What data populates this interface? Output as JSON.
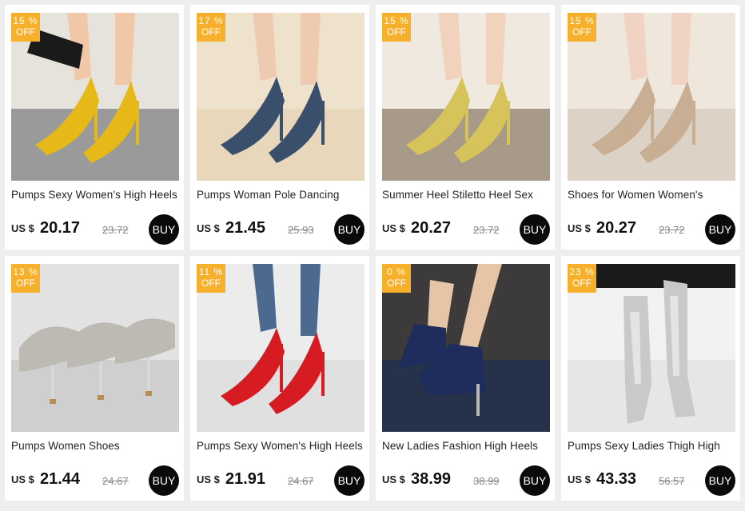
{
  "currency_label": "US $",
  "discount_suffix": "OFF",
  "buy_label": "BUY",
  "products": [
    {
      "title": "Pumps Sexy Women's High Heels",
      "discount": "15 %",
      "price": "20.17",
      "old_price": "23.72",
      "image": {
        "bg": "#e6e2dc",
        "floor": "#9a9a9a",
        "shoe": "#e6b818",
        "leg": "#f0c8a8",
        "accent": "#1a1a1a"
      }
    },
    {
      "title": "Pumps Woman Pole Dancing",
      "discount": "17 %",
      "price": "21.45",
      "old_price": "25.93",
      "image": {
        "bg": "#efe2cc",
        "floor": "#e9d7bc",
        "shoe": "#3a4f6c",
        "leg": "#edcab0",
        "accent": "#111111"
      }
    },
    {
      "title": "Summer Heel Stiletto Heel Sex",
      "discount": "15 %",
      "price": "20.27",
      "old_price": "23.72",
      "image": {
        "bg": "#efe9df",
        "floor": "#a79a88",
        "shoe": "#d6c35a",
        "leg": "#f0d2bd",
        "accent": "#ffffff"
      }
    },
    {
      "title": "Shoes for Women Women's",
      "discount": "15 %",
      "price": "20.27",
      "old_price": "23.72",
      "image": {
        "bg": "#efe6dc",
        "floor": "#dcd2c6",
        "shoe": "#c8ae92",
        "leg": "#f0d3c2",
        "accent": "#f3efe8"
      }
    },
    {
      "title": "Pumps  Women Shoes",
      "discount": "13 %",
      "price": "21.44",
      "old_price": "24.67",
      "image": {
        "bg": "#e2e2e2",
        "floor": "#cfcfcf",
        "shoe": "#bcbab2",
        "leg": "#c8c8c8",
        "accent": "#b88d55"
      }
    },
    {
      "title": "Pumps Sexy Women's High Heels",
      "discount": "11 %",
      "price": "21.91",
      "old_price": "24.67",
      "image": {
        "bg": "#ececec",
        "floor": "#e0e0e0",
        "shoe": "#d61c22",
        "leg": "#4c6a90",
        "accent": "#e0e0e0"
      }
    },
    {
      "title": "New Ladies Fashion High Heels",
      "discount": "0 %",
      "price": "38.99",
      "old_price": "38.99",
      "image": {
        "bg": "#3c3a3a",
        "floor": "#26324a",
        "shoe": "#1f2d5c",
        "leg": "#e6c5a6",
        "accent": "#b8b8b8"
      }
    },
    {
      "title": "Pumps Sexy Ladies Thigh High",
      "discount": "23 %",
      "price": "43.33",
      "old_price": "56.57",
      "image": {
        "bg": "#f2f2f2",
        "floor": "#e6e6e6",
        "shoe": "#c9c9c9",
        "leg": "#1a1a1a",
        "accent": "#8a8a8a"
      }
    }
  ]
}
